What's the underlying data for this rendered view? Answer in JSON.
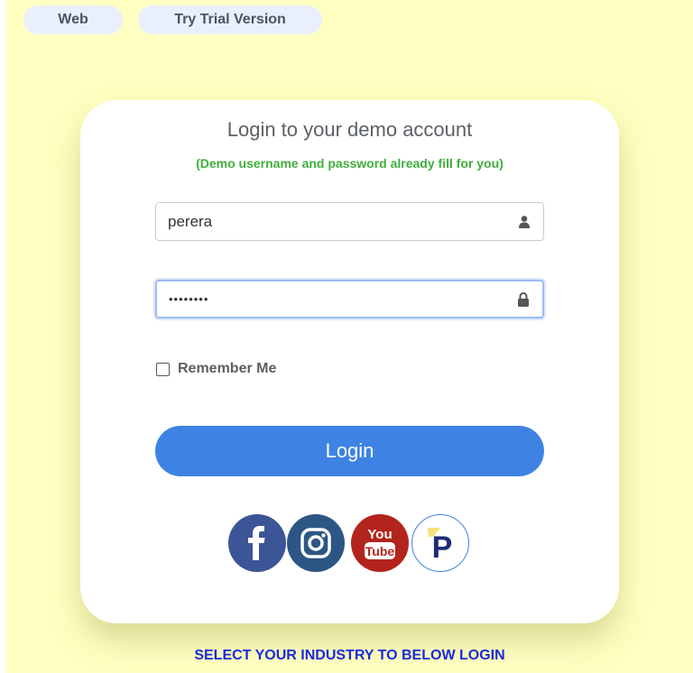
{
  "top_tabs": {
    "web": "Web",
    "trial": "Try Trial Version"
  },
  "login": {
    "title": "Login to your demo account",
    "subtitle": "(Demo username and password already fill for you)",
    "username_value": "perera",
    "password_value": "••••••••",
    "remember_label": "Remember Me",
    "login_button": "Login"
  },
  "social": {
    "youtube_top": "You",
    "youtube_bottom": "Tube",
    "brand_letter": "P"
  },
  "footer": {
    "industry_link": "SELECT YOUR INDUSTRY TO BELOW LOGIN"
  },
  "colors": {
    "background": "#ffffc2",
    "accent": "#3e83e3",
    "subtitle": "#3fae3c",
    "link": "#1a2bdc"
  },
  "icons": {
    "username": "user-icon",
    "password": "lock-icon",
    "facebook": "facebook-icon",
    "instagram": "instagram-icon",
    "youtube": "youtube-icon",
    "brand": "brand-logo-icon"
  }
}
